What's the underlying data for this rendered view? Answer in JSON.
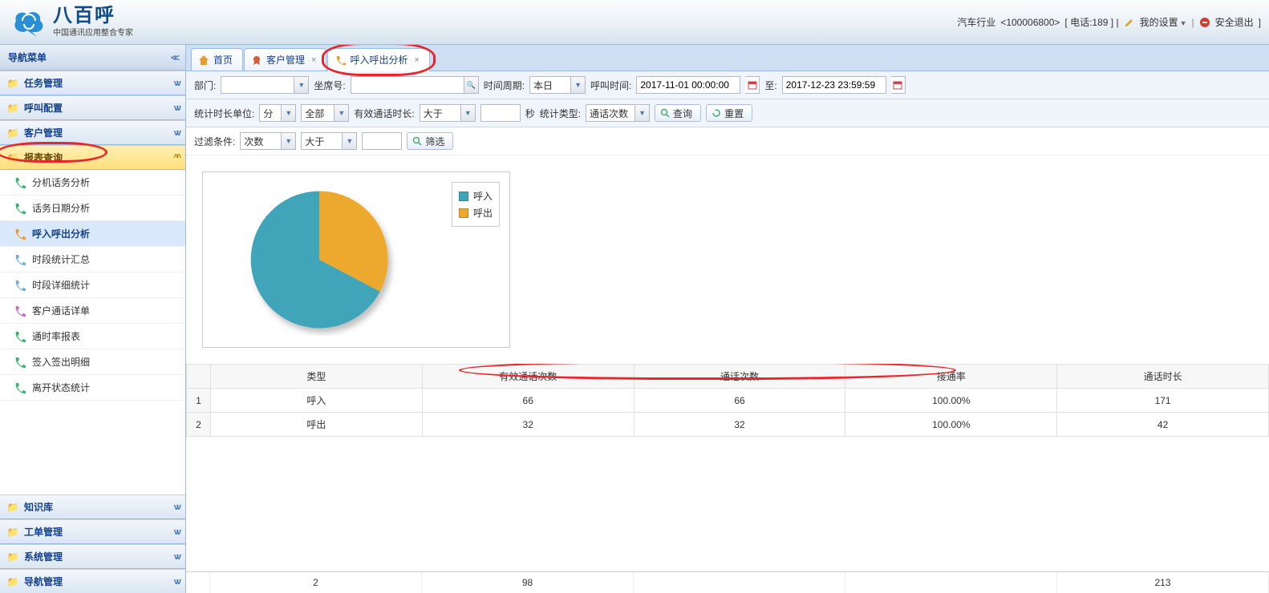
{
  "header": {
    "logo_title": "八百呼",
    "logo_sub": "中国通讯应用整合专家",
    "industry": "汽车行业",
    "account_code": "<100006800>",
    "phone_label": "[ 电话:189 ] |",
    "settings_label": "我的设置",
    "logout_label": "安全退出"
  },
  "sidebar": {
    "title": "导航菜单",
    "panels": [
      {
        "label": "任务管理"
      },
      {
        "label": "呼叫配置"
      },
      {
        "label": "客户管理"
      },
      {
        "label": "报表查询",
        "active": true
      },
      {
        "label": "知识库"
      },
      {
        "label": "工单管理"
      },
      {
        "label": "系统管理"
      },
      {
        "label": "导航管理"
      }
    ],
    "report_items": [
      {
        "label": "分机话务分析"
      },
      {
        "label": "话务日期分析"
      },
      {
        "label": "呼入呼出分析",
        "selected": true
      },
      {
        "label": "时段统计汇总"
      },
      {
        "label": "时段详细统计"
      },
      {
        "label": "客户通话详单"
      },
      {
        "label": "通时率报表"
      },
      {
        "label": "签入签出明细"
      },
      {
        "label": "离开状态统计"
      }
    ]
  },
  "tabs": [
    {
      "label": "首页",
      "icon": "home"
    },
    {
      "label": "客户管理",
      "icon": "medal",
      "closable": true
    },
    {
      "label": "呼入呼出分析",
      "icon": "phone",
      "closable": true,
      "active": true,
      "ring": true
    }
  ],
  "filters": {
    "dept_label": "部门:",
    "dept_value": "",
    "seat_label": "坐席号:",
    "seat_value": "",
    "period_label": "时间周期:",
    "period_value": "本日",
    "calltime_label": "呼叫时间:",
    "start_time": "2017-11-01 00:00:00",
    "to_label": "至:",
    "end_time": "2017-12-23 23:59:59",
    "duration_unit_label": "统计时长单位:",
    "duration_unit_value": "分",
    "scope_value": "全部",
    "effective_label": "有效通话时长:",
    "compare_value": "大于",
    "seconds_label": "秒",
    "stat_type_label": "统计类型:",
    "stat_type_value": "通话次数",
    "query_btn": "查询",
    "reset_btn": "重置",
    "filter_cond_label": "过滤条件:",
    "filter_metric": "次数",
    "filter_op": "大于",
    "filter_btn": "筛选"
  },
  "chart_data": {
    "type": "pie",
    "series": [
      {
        "name": "呼入",
        "value": 66,
        "color": "#3fa5b8"
      },
      {
        "name": "呼出",
        "value": 32,
        "color": "#eda92e"
      }
    ]
  },
  "table": {
    "columns": [
      "类型",
      "有效通话次数",
      "通话次数",
      "接通率",
      "通话时长"
    ],
    "rows": [
      {
        "n": "1",
        "type": "呼入",
        "eff": "66",
        "cnt": "66",
        "rate": "100.00%",
        "dur": "171"
      },
      {
        "n": "2",
        "type": "呼出",
        "eff": "32",
        "cnt": "32",
        "rate": "100.00%",
        "dur": "42"
      }
    ],
    "footer": {
      "count": "2",
      "eff": "98",
      "cnt": "",
      "rate": "",
      "dur": "213"
    }
  },
  "colors": {
    "accent_blue": "#15428b",
    "border_blue": "#99bbe8",
    "highlight_red": "#e8252b",
    "pie_in": "#3fa5b8",
    "pie_out": "#eda92e"
  }
}
